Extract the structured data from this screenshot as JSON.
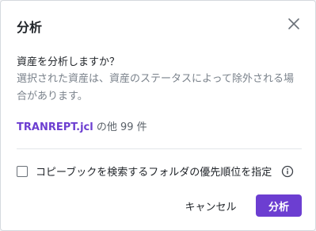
{
  "dialog": {
    "title": "分析",
    "question": "資産を分析しますか？",
    "description": "選択された資産は、資産のステータスによって除外される場合があります。",
    "asset_name": "TRANREPT.jcl",
    "asset_suffix": " の他 99 件",
    "option_label": "コピーブックを検索するフォルダの優先順位を指定",
    "option_checked": false,
    "cancel_label": "キャンセル",
    "analyze_label": "分析"
  },
  "colors": {
    "accent": "#6c3ed1",
    "muted_text": "#7a828b"
  },
  "icons": {
    "close": "close-icon",
    "info": "info-icon"
  }
}
